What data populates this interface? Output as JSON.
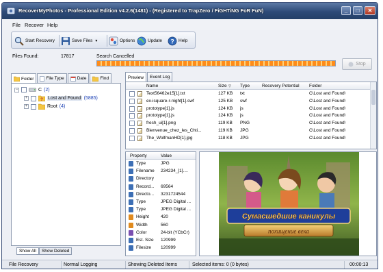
{
  "window": {
    "title": "RecoverMyPhotos - Professional Edition v4.2.6(1481)  -  (Registered to TrapZero / FiGHTiNG FoR FuN)",
    "controls": {
      "minimize": "_",
      "maximize": "□",
      "close": "✕"
    }
  },
  "menu": [
    "File",
    "Recover",
    "Help"
  ],
  "toolbar": {
    "start_recovery": "Start Recovery",
    "save_files": "Save Files",
    "options": "Options",
    "update": "Update",
    "help": "Help"
  },
  "status": {
    "files_found_label": "Files Found:",
    "files_found_value": "17817",
    "search_status": "Search Cancelled",
    "progress": 1.0,
    "stop_label": "Stop"
  },
  "left_tabs": [
    "Folder",
    "File Type",
    "Date",
    "Find"
  ],
  "tree": [
    {
      "label": "C",
      "count": "(2)",
      "level": 0,
      "expander": "−"
    },
    {
      "label": "Lost and Found",
      "count": "(5885)",
      "level": 1,
      "expander": "+"
    },
    {
      "label": "Root",
      "count": "(4)",
      "level": 1,
      "expander": "+"
    }
  ],
  "left_bottom_tabs": [
    "Show All",
    "Show Deleted"
  ],
  "right_tabs": [
    "Preview",
    "Event Log"
  ],
  "file_list": {
    "columns": [
      "Name",
      "Size",
      "Type",
      "Recovery Potential",
      "Folder"
    ],
    "rows": [
      {
        "name": "Text56462e15[1].txt",
        "size": "127 KB",
        "type": "txt",
        "folder": "C\\Lost and Found\\"
      },
      {
        "name": "ex-isquare-r-night[1].swf",
        "size": "125 KB",
        "type": "swf",
        "folder": "C\\Lost and Found\\"
      },
      {
        "name": "prototype[1].js",
        "size": "124 KB",
        "type": "js",
        "folder": "C\\Lost and Found\\"
      },
      {
        "name": "prototype[1].js",
        "size": "124 KB",
        "type": "js",
        "folder": "C\\Lost and Found\\"
      },
      {
        "name": "fresh_ui[1].png",
        "size": "119 KB",
        "type": "PNG",
        "folder": "C\\Lost and Found\\"
      },
      {
        "name": "Bienvenue_chez_les_Chti...",
        "size": "119 KB",
        "type": "JPG",
        "folder": "C\\Lost and Found\\"
      },
      {
        "name": "The_WolfmanHD[1].jpg",
        "size": "118 KB",
        "type": "JPG",
        "folder": "C\\Lost and Found\\"
      }
    ]
  },
  "properties": {
    "columns": [
      "Property",
      "Value"
    ],
    "rows": [
      {
        "property": "Type",
        "value": "JPG",
        "icon_color": "#3d6fb5"
      },
      {
        "property": "Filename",
        "value": "234234_[1]....",
        "icon_color": "#3d6fb5"
      },
      {
        "property": "Directory",
        "value": "",
        "icon_color": "#3d6fb5"
      },
      {
        "property": "Record...",
        "value": "69564",
        "icon_color": "#3d6fb5"
      },
      {
        "property": "Directo...",
        "value": "3231724544",
        "icon_color": "#3d6fb5"
      },
      {
        "property": "Type",
        "value": "JPEG Digital ...",
        "icon_color": "#3d6fb5"
      },
      {
        "property": "Type",
        "value": "JPEG Digital ...",
        "icon_color": "#3d6fb5"
      },
      {
        "property": "Height",
        "value": "420",
        "icon_color": "#e08a1e"
      },
      {
        "property": "Width",
        "value": "560",
        "icon_color": "#e08a1e"
      },
      {
        "property": "Color",
        "value": "24-bit (YCbCr)",
        "icon_color": "#7a4fb0"
      },
      {
        "property": "Est. Size",
        "value": "120999",
        "icon_color": "#3d6fb5"
      },
      {
        "property": "Filesize",
        "value": "120999",
        "icon_color": "#3d6fb5"
      }
    ]
  },
  "preview": {
    "title_line1": "Сумасшедшие каникулы",
    "title_line2": "похищение века"
  },
  "statusbar": {
    "mode": "File Recovery",
    "logging": "Normal Logging",
    "showing": "Showing Deleted Items",
    "selected": "Selected items: 0 (0 bytes)",
    "timer": "00:00:13"
  }
}
